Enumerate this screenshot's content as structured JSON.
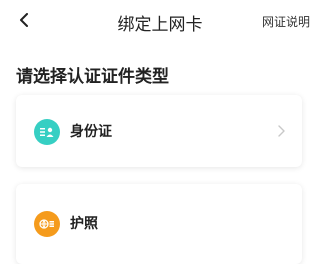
{
  "nav": {
    "back_icon": "chevron-left-icon",
    "title": "绑定上网卡",
    "right_link": "网证说明"
  },
  "section": {
    "title": "请选择认证证件类型"
  },
  "doc_types": [
    {
      "label": "身份证",
      "icon": "id-card-icon",
      "icon_color": "#36cfc3",
      "has_chevron": true
    },
    {
      "label": "护照",
      "icon": "passport-globe-icon",
      "icon_color": "#f59b1c",
      "has_chevron": false
    }
  ]
}
